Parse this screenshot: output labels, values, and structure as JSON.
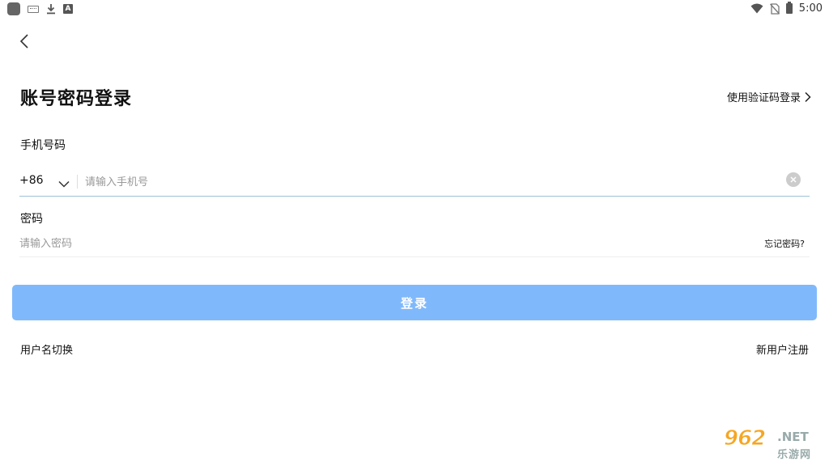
{
  "status_bar": {
    "time": "5:00",
    "left_icons": [
      "app-icon",
      "keyboard-icon",
      "download-icon",
      "text-icon"
    ],
    "right_icons": [
      "wifi-icon",
      "no-sim-icon",
      "battery-icon"
    ],
    "a_glyph": "A"
  },
  "header": {
    "title": "账号密码登录",
    "sms_login_label": "使用验证码登录"
  },
  "form": {
    "phone_label": "手机号码",
    "country_code": "+86",
    "phone_placeholder": "请输入手机号",
    "password_label": "密码",
    "password_placeholder": "请输入密码",
    "forgot_label": "忘记密码?",
    "login_button": "登录"
  },
  "footer": {
    "switch_username": "用户名切换",
    "register": "新用户注册"
  },
  "watermark": {
    "number": "962",
    "net": ".NET",
    "cn": "乐游网"
  },
  "colors": {
    "login_button": "#80b9fb",
    "phone_underline": "#9ec3d6"
  }
}
